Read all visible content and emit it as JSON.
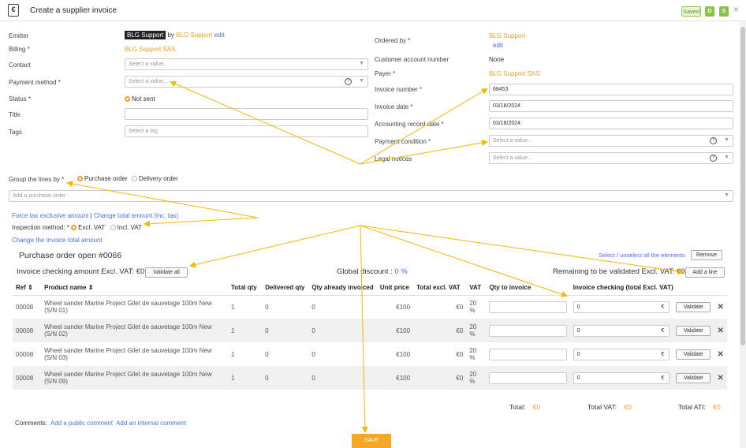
{
  "header": {
    "icon": "invoice-euro-icon",
    "title": "Create a supplier invoice",
    "saved": "Saved",
    "d": "D",
    "s": "S",
    "close": "×"
  },
  "left": {
    "emitter_label": "Emitter",
    "emitter_tag": "BLG Support",
    "emitter_by": "by",
    "emitter_name": "BLG Support",
    "emitter_edit": "edit",
    "billing_label": "Billing *",
    "billing_value": "BLG Support SAS",
    "contact_label": "Contact",
    "contact_placeholder": "Select a value...",
    "payment_label": "Payment method *",
    "payment_placeholder": "Select a value...",
    "status_label": "Status *",
    "status_value": "Not sent",
    "title_label": "Title",
    "tags_label": "Tags",
    "tags_placeholder": "Select a tag"
  },
  "right": {
    "ordered_label": "Ordered by *",
    "ordered_value": "BLG Support",
    "ordered_edit": "edit",
    "account_label": "Customer account number",
    "account_value": "None",
    "payer_label": "Payer *",
    "payer_value": "BLG Support SAS",
    "invnum_label": "Invoice number *",
    "invnum_value": "68453",
    "invdate_label": "Invoice date *",
    "invdate_value": "03/18/2024",
    "accdate_label": "Accounting record date *",
    "accdate_value": "03/18/2024",
    "paycond_label": "Payment condition *",
    "paycond_placeholder": "Select a value...",
    "legal_label": "Legal notices",
    "legal_placeholder": "Select a value..."
  },
  "group": {
    "label": "Group the lines by *",
    "opt1": "Purchase order",
    "opt2": "Delivery order",
    "po_placeholder": "Add a purchase order"
  },
  "links": {
    "force": "Force tax exclusive amount",
    "sep": "|",
    "change_total": "Change total amount (inc. tax)",
    "insp_label": "Inspection method: *",
    "excl": "Excl. VAT",
    "incl": "Incl. VAT",
    "change_invoice": "Change the invoice total amount"
  },
  "po": {
    "title": "Purchase order open #0066",
    "select_all": "Select / unselect all the elements",
    "remove": "Remove",
    "checking": "Invoice checking amount Excl. VAT: €0",
    "validate_all": "Validate all",
    "discount_label": "Global discount :",
    "discount_value": "0 %",
    "remaining": "Remaining to be validated Excl. VAT: €0",
    "add_line": "Add a line"
  },
  "table": {
    "headers": [
      "Ref ⇕",
      "Product name ⇕",
      "Total qty",
      "Delivered qty",
      "Qty already invoiced",
      "Unit price",
      "Total excl. VAT",
      "VAT",
      "Qty to invoice",
      "Invoice checking (total Excl. VAT)"
    ],
    "rows": [
      {
        "ref": "00008",
        "name": "Wheel sander Marine Project Gilet de sauvetage 100m New (S/N 01)",
        "total": "1",
        "delivered": "0",
        "invoiced": "0",
        "price": "€100",
        "excl": "€0",
        "vat": "20 %",
        "check": "0",
        "eur": "€",
        "validate": "Validate",
        "remove": "✕"
      },
      {
        "ref": "00008",
        "name": "Wheel sander Marine Project Gilet de sauvetage 100m New (S/N 02)",
        "total": "1",
        "delivered": "0",
        "invoiced": "0",
        "price": "€100",
        "excl": "€0",
        "vat": "20 %",
        "check": "0",
        "eur": "€",
        "validate": "Validate",
        "remove": "✕"
      },
      {
        "ref": "00008",
        "name": "Wheel sander Marine Project Gilet de sauvetage 100m New (S/N 03)",
        "total": "1",
        "delivered": "0",
        "invoiced": "0",
        "price": "€100",
        "excl": "€0",
        "vat": "20 %",
        "check": "0",
        "eur": "€",
        "validate": "Validate",
        "remove": "✕"
      },
      {
        "ref": "00008",
        "name": "Wheel sander Marine Project Gilet de sauvetage 100m New (S/N 09)",
        "total": "1",
        "delivered": "0",
        "invoiced": "0",
        "price": "€100",
        "excl": "€0",
        "vat": "20 %",
        "check": "0",
        "eur": "€",
        "validate": "Validate",
        "remove": "✕"
      }
    ]
  },
  "totals": {
    "total_label": "Total:",
    "total_value": "€0",
    "vat_label": "Total VAT:",
    "vat_value": "€0",
    "ati_label": "Total ATI:",
    "ati_value": "€0"
  },
  "comments": {
    "label": "Comments:",
    "public": "Add a public comment",
    "internal": "Add an internal comment"
  },
  "save": "SAVE",
  "colors": {
    "accent": "#f5a623",
    "link": "#4a6ee0",
    "valid": "#8bc34a"
  }
}
